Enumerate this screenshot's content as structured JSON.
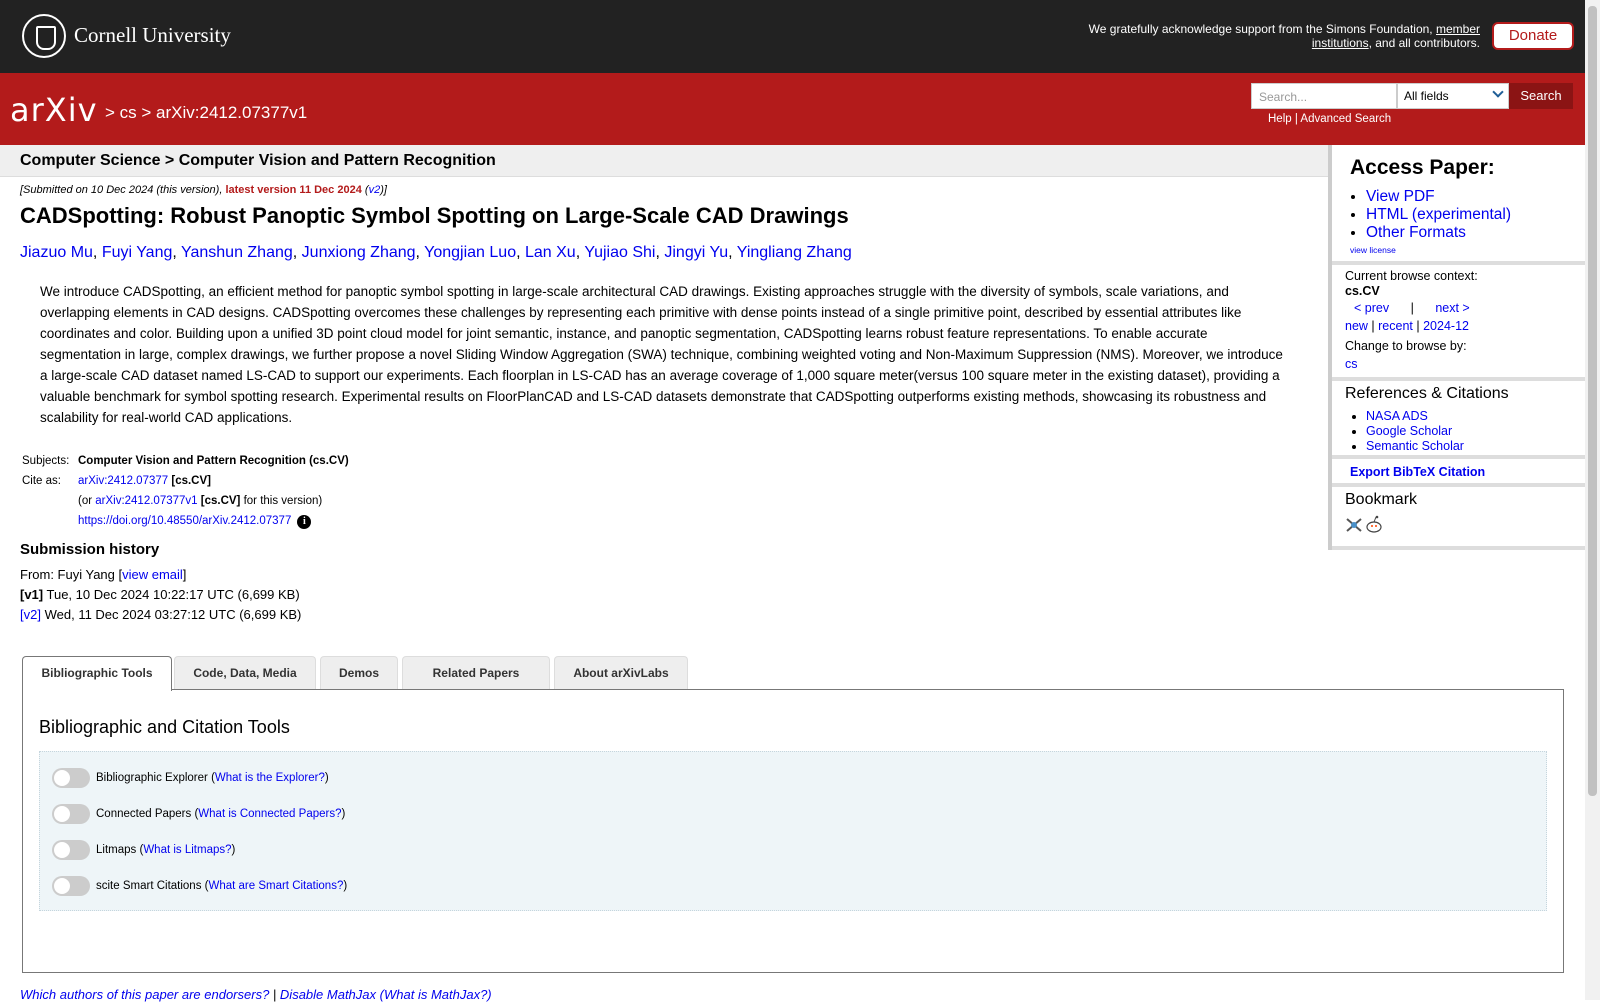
{
  "topbar": {
    "university": "Cornell University",
    "support_text": "We gratefully acknowledge support from the Simons Foundation,",
    "support_link": "member institutions",
    "support_tail": ", and all contributors.",
    "donate": "Donate"
  },
  "header": {
    "logo": "arXiv",
    "crumb_cs": "cs",
    "crumb_id": "arXiv:2412.07377v1",
    "search_placeholder": "Search...",
    "search_field": "All fields",
    "search_button": "Search",
    "help": "Help",
    "advanced": "Advanced Search"
  },
  "subhead": {
    "title": "Computer Science > Computer Vision and Pattern Recognition"
  },
  "paper": {
    "submitted": "[Submitted on 10 Dec 2024 (this version), ",
    "latest": "latest version 11 Dec 2024",
    "latest_v": "v2",
    "title": "CADSpotting: Robust Panoptic Symbol Spotting on Large-Scale CAD Drawings",
    "authors": [
      "Jiazuo Mu",
      "Fuyi Yang",
      "Yanshun Zhang",
      "Junxiong Zhang",
      "Yongjian Luo",
      "Lan Xu",
      "Yujiao Shi",
      "Jingyi Yu",
      "Yingliang Zhang"
    ],
    "abstract": "We introduce CADSpotting, an efficient method for panoptic symbol spotting in large-scale architectural CAD drawings. Existing approaches struggle with the diversity of symbols, scale variations, and overlapping elements in CAD designs. CADSpotting overcomes these challenges by representing each primitive with dense points instead of a single primitive point, described by essential attributes like coordinates and color. Building upon a unified 3D point cloud model for joint semantic, instance, and panoptic segmentation, CADSpotting learns robust feature representations. To enable accurate segmentation in large, complex drawings, we further propose a novel Sliding Window Aggregation (SWA) technique, combining weighted voting and Non-Maximum Suppression (NMS). Moreover, we introduce a large-scale CAD dataset named LS-CAD to support our experiments. Each floorplan in LS-CAD has an average coverage of 1,000 square meter(versus 100 square meter in the existing dataset), providing a valuable benchmark for symbol spotting research. Experimental results on FloorPlanCAD and LS-CAD datasets demonstrate that CADSpotting outperforms existing methods, showcasing its robustness and scalability for real-world CAD applications.",
    "subjects_label": "Subjects:",
    "subjects": "Computer Vision and Pattern Recognition (cs.CV)",
    "cite_label": "Cite as:",
    "cite_id": "arXiv:2412.07377",
    "cite_cat": "[cs.CV]",
    "cite_or": "(or ",
    "cite_v1": "arXiv:2412.07377v1",
    "cite_v1_tail": "for this version)",
    "doi": "https://doi.org/10.48550/arXiv.2412.07377"
  },
  "history": {
    "title": "Submission history",
    "from": "From: Fuyi Yang [",
    "view_email": "view email",
    "v1_label": "[v1]",
    "v1_text": "Tue, 10 Dec 2024 10:22:17 UTC (6,699 KB)",
    "v2_label": "[v2]",
    "v2_text": "Wed, 11 Dec 2024 03:27:12 UTC (6,699 KB)"
  },
  "tabs": [
    "Bibliographic Tools",
    "Code, Data, Media",
    "Demos",
    "Related Papers",
    "About arXivLabs"
  ],
  "panel": {
    "title": "Bibliographic and Citation Tools",
    "tools": [
      {
        "name": "Bibliographic Explorer",
        "help": "What is the Explorer?"
      },
      {
        "name": "Connected Papers",
        "help": "What is Connected Papers?"
      },
      {
        "name": "Litmaps",
        "help": "What is Litmaps?"
      },
      {
        "name": "scite Smart Citations",
        "help": "What are Smart Citations?"
      }
    ]
  },
  "footer": {
    "endorsers": "Which authors of this paper are endorsers?",
    "sep": " | ",
    "mathjax": "Disable MathJax",
    "what_mathjax": "(What is MathJax?)"
  },
  "sidebar": {
    "access_title": "Access Paper:",
    "access_links": [
      "View PDF",
      "HTML (experimental)",
      "Other Formats"
    ],
    "view_license": "view license",
    "context_label": "Current browse context:",
    "context": "cs.CV",
    "prev": "< prev",
    "sep": "|",
    "next": "next >",
    "new": "new",
    "recent": "recent",
    "month": "2024-12",
    "change_label": "Change to browse by:",
    "browse_cs": "cs",
    "refs_title": "References & Citations",
    "refs": [
      "NASA ADS",
      "Google Scholar",
      "Semantic Scholar"
    ],
    "export": "Export BibTeX Citation",
    "bookmark": "Bookmark"
  },
  "colors": {
    "arxiv_red": "#b31b1b",
    "cornell_dark": "#222222",
    "link": "#0000ee"
  }
}
